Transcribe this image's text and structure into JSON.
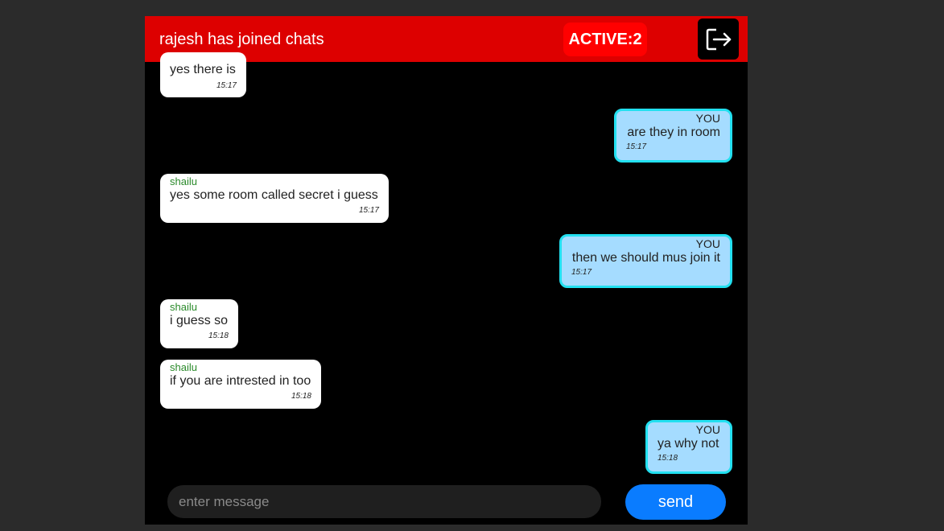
{
  "header": {
    "title": "rajesh has joined chats",
    "active_label": "ACTIVE:2",
    "exit_icon": "logout-icon"
  },
  "messages": [
    {
      "side": "other",
      "sender": "",
      "text": "yes there is",
      "time": "15:17"
    },
    {
      "side": "mine",
      "sender": "YOU",
      "text": "are they in room",
      "time": "15:17"
    },
    {
      "side": "other",
      "sender": "shailu",
      "text": "yes some room called secret i guess",
      "time": "15:17"
    },
    {
      "side": "mine",
      "sender": "YOU",
      "text": "then we should mus join it",
      "time": "15:17"
    },
    {
      "side": "other",
      "sender": "shailu",
      "text": "i guess so",
      "time": "15:18"
    },
    {
      "side": "other",
      "sender": "shailu",
      "text": "if you are intrested in too",
      "time": "15:18"
    },
    {
      "side": "mine",
      "sender": "YOU",
      "text": "ya why not",
      "time": "15:18"
    }
  ],
  "composer": {
    "placeholder": "enter message",
    "value": "",
    "send_label": "send"
  },
  "colors": {
    "header": "#dd0000",
    "active_badge": "#ff0000",
    "my_bubble": "#a5dcff",
    "my_bubble_border": "#22e0f0",
    "other_bubble": "#ffffff",
    "sender_name": "#2a8a2a",
    "send_button": "#0a7cff"
  }
}
